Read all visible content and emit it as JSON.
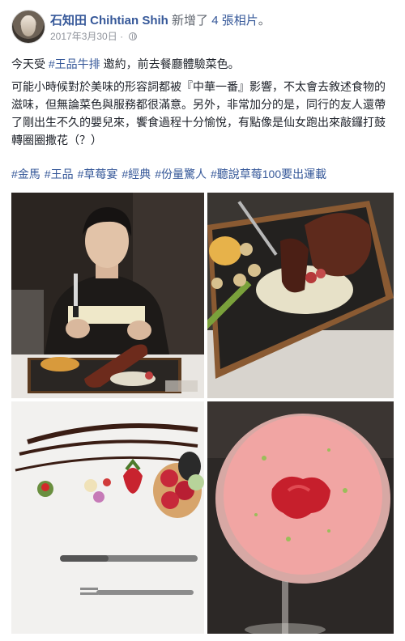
{
  "post": {
    "author_name": "石知田 Chihtian Shih",
    "action_text": "新增了",
    "photos_link": "4 張相片",
    "end_punct": "。",
    "date": "2017年3月30日",
    "date_sep": "·",
    "privacy_icon": "globe-icon",
    "p1": {
      "before": "今天受 ",
      "hashtag": "#王品牛排",
      "after": " 邀約，前去餐廳體驗菜色。"
    },
    "p2": "可能小時候對於美味的形容詞都被『中華一番』影響，不太會去敘述食物的滋味，但無論菜色與服務都很滿意。另外，非常加分的是，同行的友人還帶了剛出生不久的嬰兒來，饗食過程十分愉悅，有點像是仙女跑出來敲鑼打鼓轉圈圈撒花（？）",
    "hashtags": [
      "#金馬",
      "#王品",
      "#草莓宴",
      "#經典",
      "#份量驚人",
      "#聽說草莓100要出運載"
    ]
  },
  "photos": [
    {
      "subject": "man-with-steak-photo"
    },
    {
      "subject": "steak-platter-photo"
    },
    {
      "subject": "strawberry-dessert-plate-photo"
    },
    {
      "subject": "strawberry-drink-photo"
    }
  ],
  "colors": {
    "link": "#365899",
    "meta": "#90949c",
    "text": "#1d2129"
  }
}
